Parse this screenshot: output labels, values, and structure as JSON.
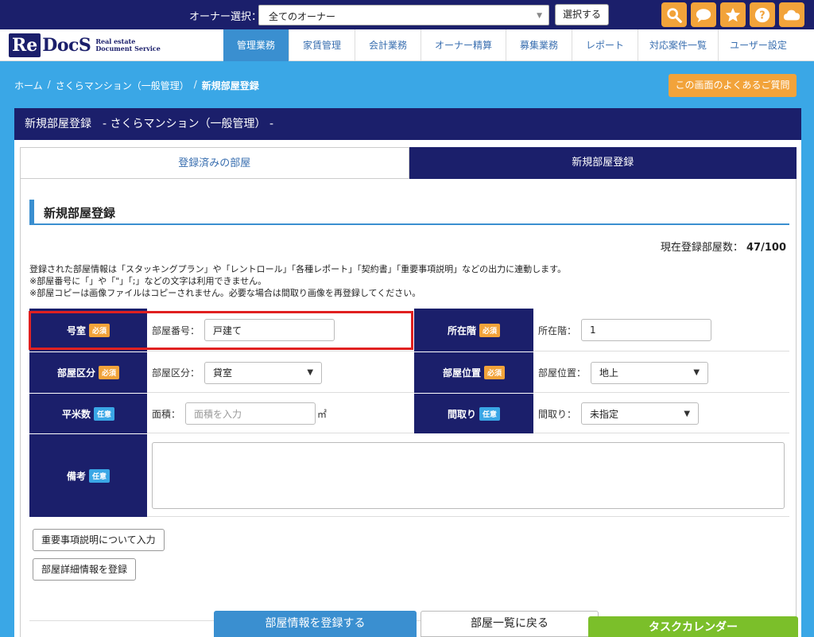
{
  "topbar": {
    "owner_label": "オーナー選択：",
    "owner_select_value": "全てのオーナー",
    "select_button": "選択する"
  },
  "logo": {
    "re": "Re",
    "docs": "DocS",
    "sub_line1": "Real estate",
    "sub_line2": "Document Service"
  },
  "nav": {
    "items": [
      {
        "label": "管理業務"
      },
      {
        "label": "家賃管理"
      },
      {
        "label": "会計業務"
      },
      {
        "label": "オーナー精算"
      },
      {
        "label": "募集業務"
      },
      {
        "label": "レポート"
      },
      {
        "label": "対応案件一覧"
      },
      {
        "label": "ユーザー設定"
      }
    ]
  },
  "breadcrumb": {
    "home": "ホーム",
    "sep": "/",
    "parent": "さくらマンション（一般管理）",
    "current": "新規部屋登録"
  },
  "faq_button": "この画面のよくあるご質問",
  "panel_title": "新規部屋登録　- さくらマンション（一般管理） -",
  "tabs": [
    {
      "label": "登録済みの部屋"
    },
    {
      "label": "新規部屋登録"
    }
  ],
  "section_title": "新規部屋登録",
  "count": {
    "label": "現在登録部屋数：",
    "value": "47/100"
  },
  "notes": [
    "登録された部屋情報は「スタッキングプラン」や「レントロール」「各種レポート」「契約書」「重要事項説明」などの出力に連動します。",
    "※部屋番号に「」や「\"」「;」などの文字は利用できません。",
    "※部屋コピーは画像ファイルはコピーされません。必要な場合は間取り画像を再登録してください。"
  ],
  "badges": {
    "required": "必須",
    "optional": "任意"
  },
  "form": {
    "room_no": {
      "header": "号室",
      "label": "部屋番号：",
      "value": "戸建て"
    },
    "floor": {
      "header": "所在階",
      "label": "所在階：",
      "value": "1"
    },
    "room_type": {
      "header": "部屋区分",
      "label": "部屋区分：",
      "value": "貸室"
    },
    "room_position": {
      "header": "部屋位置",
      "label": "部屋位置：",
      "value": "地上"
    },
    "area": {
      "header": "平米数",
      "label": "面積：",
      "placeholder": "面積を入力",
      "unit": "㎡"
    },
    "layout": {
      "header": "間取り",
      "label": "間取り：",
      "value": "未指定"
    },
    "remarks": {
      "header": "備考"
    }
  },
  "buttons": {
    "important_matters": "重要事項説明について入力",
    "room_details": "部屋詳細情報を登録",
    "submit": "部屋情報を登録する",
    "back": "部屋一覧に戻る",
    "task_calendar": "タスクカレンダー"
  },
  "colors": {
    "navy": "#1b1f6b",
    "accent_blue": "#3a8fd0",
    "orange": "#f2a33a",
    "green": "#7bbf2a",
    "highlight_red": "#e02020"
  }
}
